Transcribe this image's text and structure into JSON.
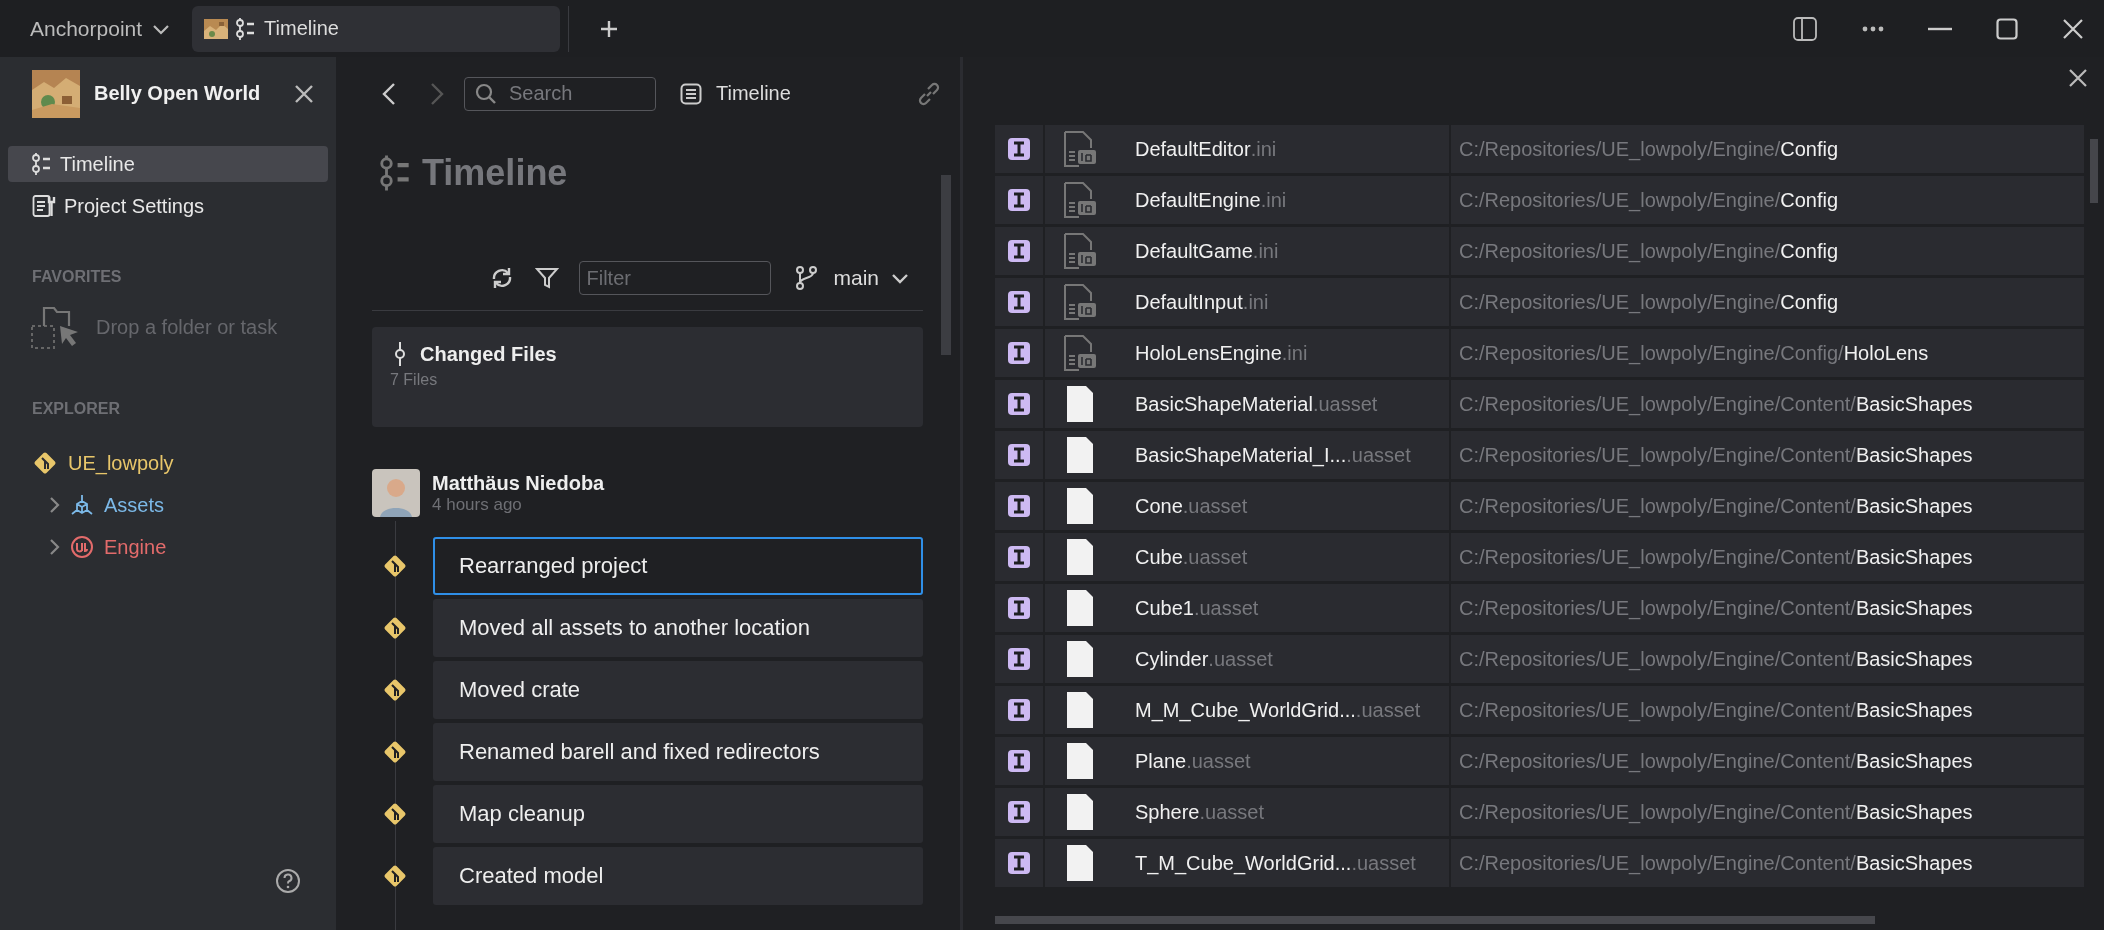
{
  "titlebar": {
    "app_menu": "Anchorpoint",
    "tab": {
      "label": "Timeline"
    }
  },
  "sidebar": {
    "project": "Belly Open World",
    "nav": [
      {
        "label": "Timeline",
        "selected": true,
        "kind": "timeline"
      },
      {
        "label": "Project Settings",
        "selected": false,
        "kind": "settings"
      }
    ],
    "favorites": {
      "heading": "FAVORITES",
      "drop_hint": "Drop a folder or task"
    },
    "explorer": {
      "heading": "EXPLORER",
      "items": [
        {
          "label": "UE_lowpoly",
          "kind": "repo",
          "color": "#e8c66a",
          "children": [
            {
              "label": "Assets",
              "kind": "assets",
              "color": "#7cb9e8",
              "expanded": false
            },
            {
              "label": "Engine",
              "kind": "engine",
              "color": "#e36b6b",
              "expanded": false
            }
          ]
        }
      ]
    }
  },
  "timeline": {
    "search_placeholder": "Search",
    "breadcrumb": "Timeline",
    "title": "Timeline",
    "filter_placeholder": "Filter",
    "branch": "main",
    "changed_files": {
      "title": "Changed Files",
      "count": "7 Files"
    },
    "author": {
      "name": "Matthäus Niedoba",
      "time": "4 hours ago"
    },
    "commits": [
      {
        "message": "Rearranged project",
        "selected": true
      },
      {
        "message": "Moved all assets to another location",
        "selected": false
      },
      {
        "message": "Moved crate",
        "selected": false
      },
      {
        "message": "Renamed barell and fixed redirectors",
        "selected": false
      },
      {
        "message": "Map cleanup",
        "selected": false
      },
      {
        "message": "Created model",
        "selected": false
      }
    ]
  },
  "files": {
    "rows": [
      {
        "kind": "ini",
        "name": "DefaultEditor",
        "ext": ".ini",
        "path": "C:/Repositories/UE_lowpoly/Engine/",
        "folder": "Config"
      },
      {
        "kind": "ini",
        "name": "DefaultEngine",
        "ext": ".ini",
        "path": "C:/Repositories/UE_lowpoly/Engine/",
        "folder": "Config"
      },
      {
        "kind": "ini",
        "name": "DefaultGame",
        "ext": ".ini",
        "path": "C:/Repositories/UE_lowpoly/Engine/",
        "folder": "Config"
      },
      {
        "kind": "ini",
        "name": "DefaultInput",
        "ext": ".ini",
        "path": "C:/Repositories/UE_lowpoly/Engine/",
        "folder": "Config"
      },
      {
        "kind": "ini",
        "name": "HoloLensEngine",
        "ext": ".ini",
        "path": "C:/Repositories/UE_lowpoly/Engine/Config/",
        "folder": "HoloLens"
      },
      {
        "kind": "asset",
        "name": "BasicShapeMaterial",
        "ext": ".uasset",
        "path": "C:/Repositories/UE_lowpoly/Engine/Content/",
        "folder": "BasicShapes"
      },
      {
        "kind": "asset",
        "name": "BasicShapeMaterial_I...",
        "ext": ".uasset",
        "path": "C:/Repositories/UE_lowpoly/Engine/Content/",
        "folder": "BasicShapes"
      },
      {
        "kind": "asset",
        "name": "Cone",
        "ext": ".uasset",
        "path": "C:/Repositories/UE_lowpoly/Engine/Content/",
        "folder": "BasicShapes"
      },
      {
        "kind": "asset",
        "name": "Cube",
        "ext": ".uasset",
        "path": "C:/Repositories/UE_lowpoly/Engine/Content/",
        "folder": "BasicShapes"
      },
      {
        "kind": "asset",
        "name": "Cube1",
        "ext": ".uasset",
        "path": "C:/Repositories/UE_lowpoly/Engine/Content/",
        "folder": "BasicShapes"
      },
      {
        "kind": "asset",
        "name": "Cylinder",
        "ext": ".uasset",
        "path": "C:/Repositories/UE_lowpoly/Engine/Content/",
        "folder": "BasicShapes"
      },
      {
        "kind": "asset",
        "name": "M_M_Cube_WorldGrid...",
        "ext": ".uasset",
        "path": "C:/Repositories/UE_lowpoly/Engine/Content/",
        "folder": "BasicShapes"
      },
      {
        "kind": "asset",
        "name": "Plane",
        "ext": ".uasset",
        "path": "C:/Repositories/UE_lowpoly/Engine/Content/",
        "folder": "BasicShapes"
      },
      {
        "kind": "asset",
        "name": "Sphere",
        "ext": ".uasset",
        "path": "C:/Repositories/UE_lowpoly/Engine/Content/",
        "folder": "BasicShapes"
      },
      {
        "kind": "asset",
        "name": "T_M_Cube_WorldGrid...",
        "ext": ".uasset",
        "path": "C:/Repositories/UE_lowpoly/Engine/Content/",
        "folder": "BasicShapes"
      }
    ]
  }
}
